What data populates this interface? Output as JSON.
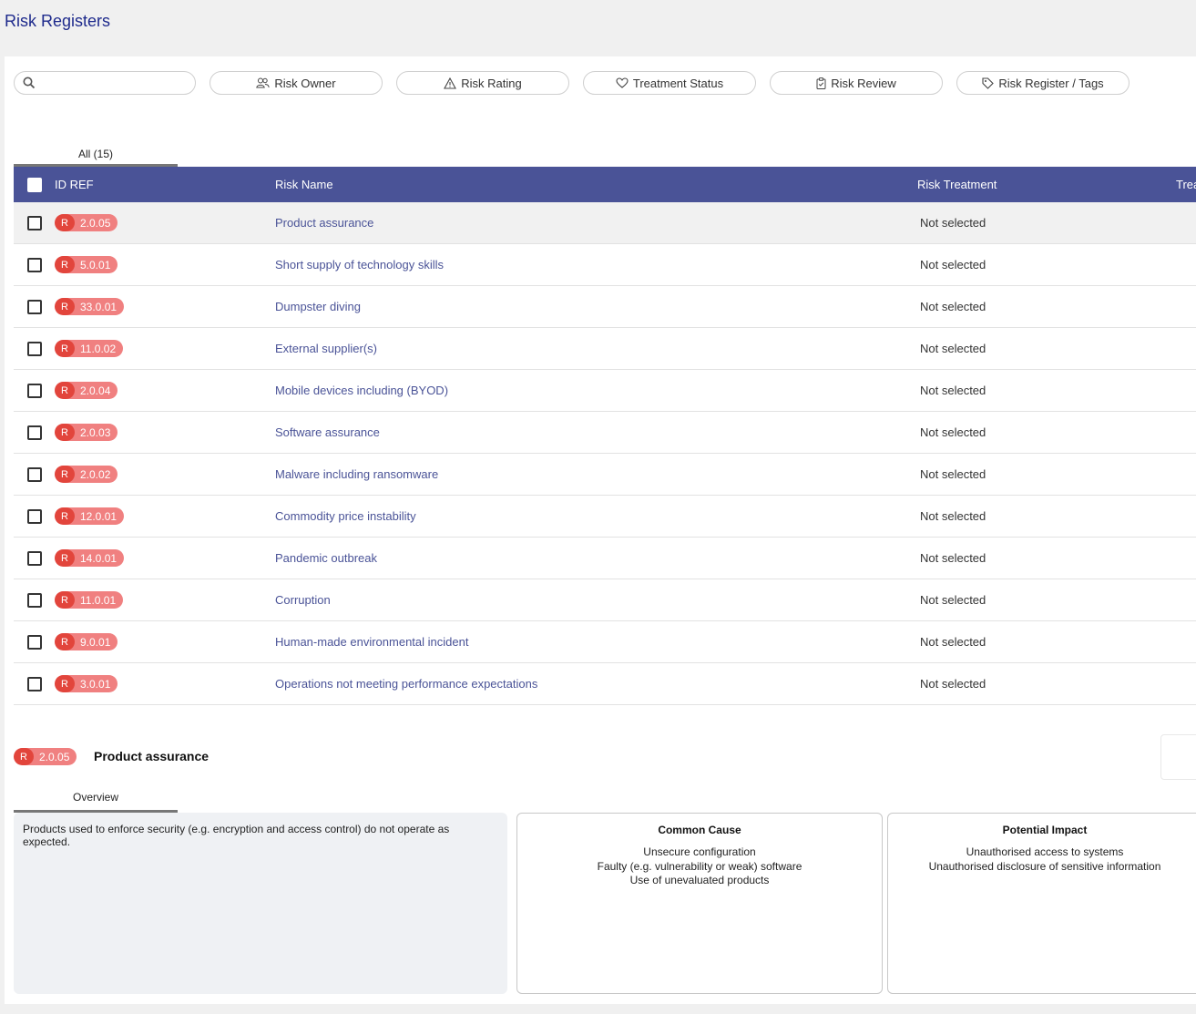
{
  "page": {
    "title": "Risk Registers"
  },
  "search": {
    "placeholder": ""
  },
  "filters": [
    {
      "label": "Risk Owner",
      "icon": "users-icon"
    },
    {
      "label": "Risk Rating",
      "icon": "warning-icon"
    },
    {
      "label": "Treatment Status",
      "icon": "heart-icon"
    },
    {
      "label": "Risk Review",
      "icon": "clipboard-icon"
    },
    {
      "label": "Risk Register / Tags",
      "icon": "tag-icon"
    }
  ],
  "tabs": {
    "all": "All (15)",
    "overview": "Overview"
  },
  "table": {
    "columns": [
      "ID REF",
      "Risk Name",
      "Risk Treatment",
      "Trea"
    ],
    "rows": [
      {
        "badge": "R",
        "id": "2.0.05",
        "name": "Product assurance",
        "treatment": "Not selected"
      },
      {
        "badge": "R",
        "id": "5.0.01",
        "name": "Short supply of technology skills",
        "treatment": "Not selected"
      },
      {
        "badge": "R",
        "id": "33.0.01",
        "name": "Dumpster diving",
        "treatment": "Not selected"
      },
      {
        "badge": "R",
        "id": "11.0.02",
        "name": "External supplier(s)",
        "treatment": "Not selected"
      },
      {
        "badge": "R",
        "id": "2.0.04",
        "name": "Mobile devices including (BYOD)",
        "treatment": "Not selected"
      },
      {
        "badge": "R",
        "id": "2.0.03",
        "name": "Software assurance",
        "treatment": "Not selected"
      },
      {
        "badge": "R",
        "id": "2.0.02",
        "name": "Malware including ransomware",
        "treatment": "Not selected"
      },
      {
        "badge": "R",
        "id": "12.0.01",
        "name": "Commodity price instability",
        "treatment": "Not selected"
      },
      {
        "badge": "R",
        "id": "14.0.01",
        "name": "Pandemic outbreak",
        "treatment": "Not selected"
      },
      {
        "badge": "R",
        "id": "11.0.01",
        "name": "Corruption",
        "treatment": "Not selected"
      },
      {
        "badge": "R",
        "id": "9.0.01",
        "name": "Human-made environmental incident",
        "treatment": "Not selected"
      },
      {
        "badge": "R",
        "id": "3.0.01",
        "name": "Operations not meeting performance expectations",
        "treatment": "Not selected"
      }
    ]
  },
  "detail": {
    "badge": "R",
    "id": "2.0.05",
    "title": "Product assurance",
    "description": "Products used to enforce security (e.g. encryption and access control) do not operate as expected.",
    "common_cause": {
      "heading": "Common Cause",
      "lines": [
        "Unsecure configuration",
        "Faulty (e.g. vulnerability or weak) software",
        "Use of unevaluated products"
      ]
    },
    "potential_impact": {
      "heading": "Potential Impact",
      "lines": [
        "Unauthorised access to systems",
        "Unauthorised disclosure of sensitive information"
      ]
    }
  },
  "colors": {
    "header_bg": "#4a5397",
    "title": "#1e2a8c",
    "badge_r": "#e2453c",
    "badge_id": "#f08080",
    "link": "#4a5397"
  }
}
